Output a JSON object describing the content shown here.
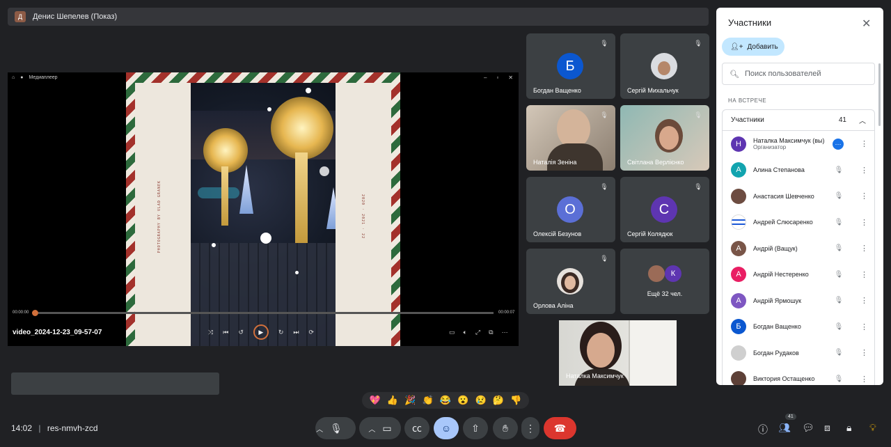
{
  "presenter_bar": {
    "title": "Денис Шепелев (Показ)"
  },
  "player": {
    "app_title": "Медиаплеер",
    "file_name": "video_2024-12-23_09-57-07",
    "time_current": "00:00:00",
    "time_total": "00:00:07",
    "frame_text_left": "PHOTOGRAPHY BY VLAD GRANEK",
    "frame_text_right": "2020 · 2021 · 22"
  },
  "tiles": [
    {
      "name": "Богдан Ващенко",
      "initial": "Б",
      "color": "#0b57d0"
    },
    {
      "name": "Сергій Михальчук",
      "initial": "",
      "color": "#e8eaed"
    },
    {
      "name": "Наталія Зеніна",
      "initial": "",
      "color": ""
    },
    {
      "name": "Світлана Верлієнко",
      "initial": "",
      "color": ""
    },
    {
      "name": "Олексій Безунов",
      "initial": "О",
      "color": "#5b6fd6"
    },
    {
      "name": "Сергій Колядюк",
      "initial": "С",
      "color": "#5e35b1"
    },
    {
      "name": "Орлова Аліна",
      "initial": "",
      "color": ""
    },
    {
      "name": "Ещё 32 чел.",
      "initial": "К",
      "color": "#5e35b1"
    }
  ],
  "self_view": {
    "name": "Наталка Максимчук"
  },
  "reactions": [
    "💖",
    "👍",
    "🎉",
    "👏",
    "😂",
    "😮",
    "😢",
    "🤔",
    "👎"
  ],
  "bottom": {
    "clock": "14:02",
    "meeting_code": "res-nmvh-zcd",
    "participants_badge": "41"
  },
  "panel": {
    "title": "Участники",
    "add_label": "Добавить",
    "search_placeholder": "Поиск пользователей",
    "section_label": "НА ВСТРЕЧЕ",
    "group_label": "Участники",
    "group_count": "41",
    "people": [
      {
        "name": "Наталка Максимчук (вы)",
        "sub": "Организатор",
        "initial": "Н",
        "color": "#5e35b1"
      },
      {
        "name": "Алина Степанова",
        "sub": "",
        "initial": "А",
        "color": "#12a4af"
      },
      {
        "name": "Анастасия Шевченко",
        "sub": "",
        "initial": "",
        "color": "#6d4c41"
      },
      {
        "name": "Андрей Слюсаренко",
        "sub": "",
        "initial": "",
        "color": "#1a57d6"
      },
      {
        "name": "Андрій (Ващук)",
        "sub": "",
        "initial": "А",
        "color": "#795548"
      },
      {
        "name": "Андрій Нестеренко",
        "sub": "",
        "initial": "А",
        "color": "#e91e63"
      },
      {
        "name": "Андрій Ярмошук",
        "sub": "",
        "initial": "А",
        "color": "#7e57c2"
      },
      {
        "name": "Богдан Ващенко",
        "sub": "",
        "initial": "Б",
        "color": "#0b57d0"
      },
      {
        "name": "Богдан Рудаков",
        "sub": "",
        "initial": "",
        "color": "#9e9e9e"
      },
      {
        "name": "Виктория Остащенко",
        "sub": "",
        "initial": "",
        "color": "#5d4037"
      }
    ]
  }
}
